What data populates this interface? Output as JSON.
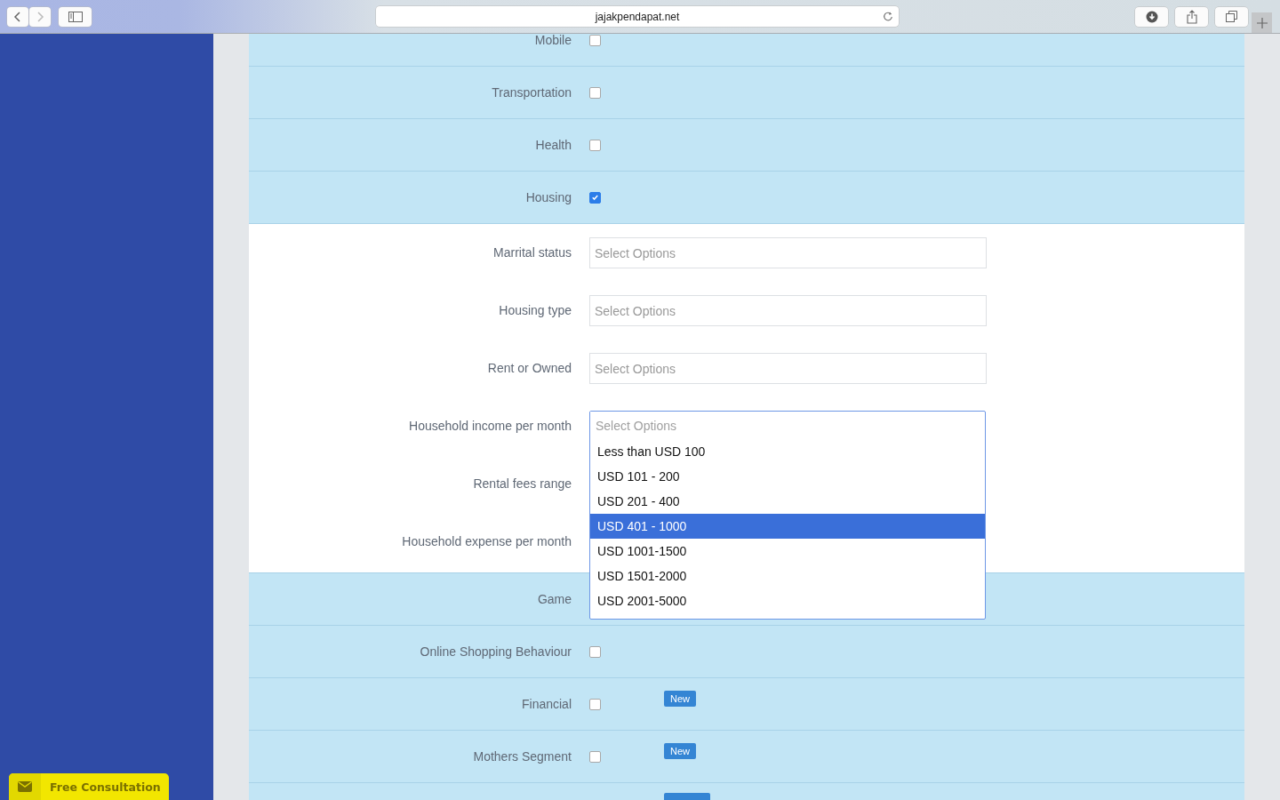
{
  "browser": {
    "address": "jajakpendapat.net"
  },
  "interest_rows": [
    {
      "label": "Mobile",
      "checked": false
    },
    {
      "label": "Transportation",
      "checked": false
    },
    {
      "label": "Health",
      "checked": false
    },
    {
      "label": "Housing",
      "checked": true
    }
  ],
  "profile_fields": [
    {
      "label": "Marrital status",
      "kind": "select",
      "placeholder": "Select Options"
    },
    {
      "label": "Housing type",
      "kind": "select",
      "placeholder": "Select Options"
    },
    {
      "label": "Rent or Owned",
      "kind": "select",
      "placeholder": "Select Options"
    },
    {
      "label": "Household income per month",
      "kind": "open-select",
      "placeholder": "Select Options",
      "options": [
        {
          "label": "Less than USD 100",
          "selected": false
        },
        {
          "label": "USD 101 - 200",
          "selected": false
        },
        {
          "label": "USD 201 - 400",
          "selected": false
        },
        {
          "label": "USD 401 - 1000",
          "selected": true
        },
        {
          "label": "USD 1001-1500",
          "selected": false
        },
        {
          "label": "USD 1501-2000",
          "selected": false
        },
        {
          "label": "USD 2001-5000",
          "selected": false
        }
      ]
    },
    {
      "label": "Rental fees range",
      "kind": "covered"
    },
    {
      "label": "Household expense per month",
      "kind": "covered"
    }
  ],
  "segment_rows": [
    {
      "label": "Game"
    },
    {
      "label": "Online Shopping Behaviour",
      "checked": false
    },
    {
      "label": "Financial",
      "checked": false,
      "badge": "New"
    },
    {
      "label": "Mothers Segment",
      "checked": false,
      "badge": "New"
    },
    {
      "kind": "cut-badge"
    }
  ],
  "consultation_button": {
    "label": "Free Consultation"
  }
}
